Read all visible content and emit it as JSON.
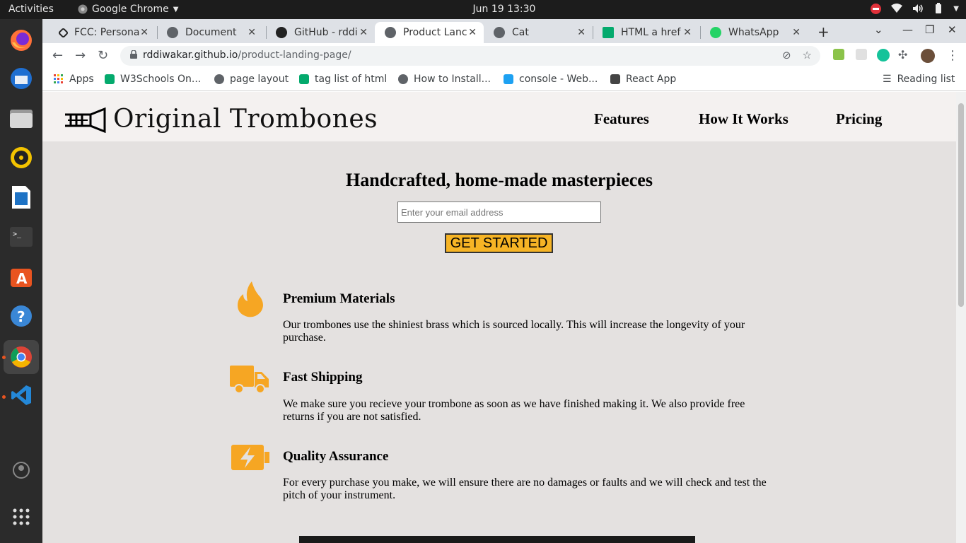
{
  "system": {
    "activities": "Activities",
    "app_name": "Google Chrome",
    "clock": "Jun 19  13:30"
  },
  "tabs": [
    {
      "title": "FCC: Persona",
      "active": false
    },
    {
      "title": "Document",
      "active": false
    },
    {
      "title": "GitHub - rddi",
      "active": false
    },
    {
      "title": "Product Lanc",
      "active": true
    },
    {
      "title": "Cat",
      "active": false
    },
    {
      "title": "HTML a href",
      "active": false
    },
    {
      "title": "WhatsApp",
      "active": false
    }
  ],
  "address_bar": {
    "host": "rddiwakar.github.io",
    "path": "/product-landing-page/"
  },
  "bookmarks": [
    {
      "label": "Apps"
    },
    {
      "label": "W3Schools On..."
    },
    {
      "label": "page layout"
    },
    {
      "label": "tag list of html"
    },
    {
      "label": "How to Install..."
    },
    {
      "label": "console - Web..."
    },
    {
      "label": "React App"
    }
  ],
  "reading_list": "Reading list",
  "site": {
    "logo_text": "Original Trombones",
    "nav": [
      "Features",
      "How It Works",
      "Pricing"
    ],
    "hero_title": "Handcrafted, home-made masterpieces",
    "email_placeholder": "Enter your email address",
    "cta_label": "GET STARTED",
    "accent_color": "#f6a623",
    "features": [
      {
        "icon": "fire-icon",
        "title": "Premium Materials",
        "description": "Our trombones use the shiniest brass which is sourced locally. This will increase the longevity of your purchase."
      },
      {
        "icon": "truck-icon",
        "title": "Fast Shipping",
        "description": "We make sure you recieve your trombone as soon as we have finished making it. We also provide free returns if you are not satisfied."
      },
      {
        "icon": "battery-bolt-icon",
        "title": "Quality Assurance",
        "description": "For every purchase you make, we will ensure there are no damages or faults and we will check and test the pitch of your instrument."
      }
    ]
  }
}
